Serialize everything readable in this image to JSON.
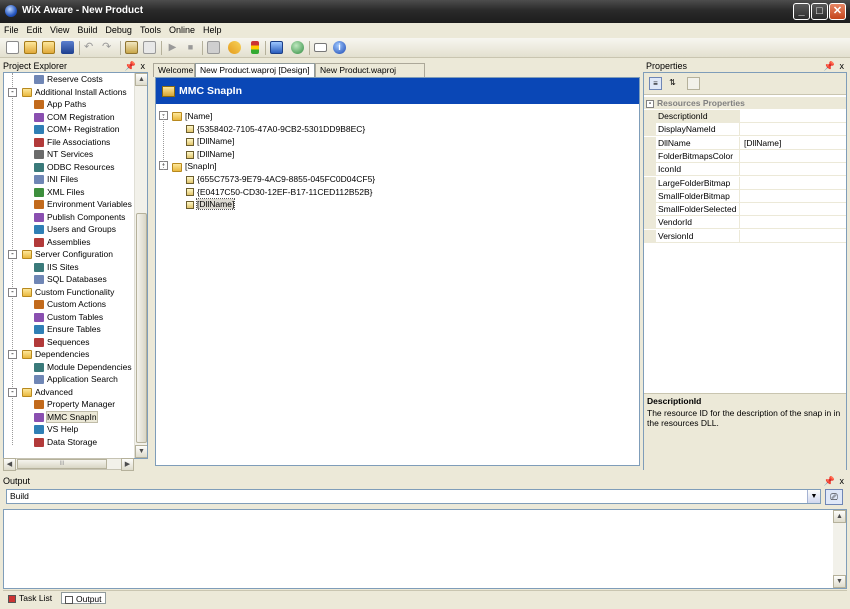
{
  "window": {
    "title": "WiX Aware - New Product"
  },
  "menu": [
    "File",
    "Edit",
    "View",
    "Build",
    "Debug",
    "Tools",
    "Online",
    "Help"
  ],
  "project_explorer": {
    "title": "Project Explorer",
    "items": [
      {
        "label": "Reserve Costs",
        "level": 2,
        "icon": "reserve-costs-icon"
      },
      {
        "label": "Additional Install Actions",
        "level": 1,
        "icon": "folder-icon",
        "expander": "-"
      },
      {
        "label": "App Paths",
        "level": 2,
        "icon": "app-paths-icon"
      },
      {
        "label": "COM Registration",
        "level": 2,
        "icon": "com-icon"
      },
      {
        "label": "COM+ Registration",
        "level": 2,
        "icon": "com-plus-icon"
      },
      {
        "label": "File Associations",
        "level": 2,
        "icon": "file-associations-icon"
      },
      {
        "label": "NT Services",
        "level": 2,
        "icon": "nt-services-icon"
      },
      {
        "label": "ODBC Resources",
        "level": 2,
        "icon": "odbc-icon"
      },
      {
        "label": "INI Files",
        "level": 2,
        "icon": "ini-icon"
      },
      {
        "label": "XML Files",
        "level": 2,
        "icon": "xml-icon"
      },
      {
        "label": "Environment Variables",
        "level": 2,
        "icon": "environment-icon"
      },
      {
        "label": "Publish Components",
        "level": 2,
        "icon": "publish-icon"
      },
      {
        "label": "Users and Groups",
        "level": 2,
        "icon": "users-icon"
      },
      {
        "label": "Assemblies",
        "level": 2,
        "icon": "assemblies-icon"
      },
      {
        "label": "Server Configuration",
        "level": 1,
        "icon": "folder-icon",
        "expander": "-"
      },
      {
        "label": "IIS Sites",
        "level": 2,
        "icon": "iis-icon"
      },
      {
        "label": "SQL Databases",
        "level": 2,
        "icon": "sql-icon"
      },
      {
        "label": "Custom Functionality",
        "level": 1,
        "icon": "folder-icon",
        "expander": "-"
      },
      {
        "label": "Custom Actions",
        "level": 2,
        "icon": "custom-actions-icon"
      },
      {
        "label": "Custom Tables",
        "level": 2,
        "icon": "custom-tables-icon"
      },
      {
        "label": "Ensure Tables",
        "level": 2,
        "icon": "ensure-tables-icon"
      },
      {
        "label": "Sequences",
        "level": 2,
        "icon": "sequences-icon"
      },
      {
        "label": "Dependencies",
        "level": 1,
        "icon": "folder-icon",
        "expander": "-"
      },
      {
        "label": "Module Dependencies",
        "level": 2,
        "icon": "module-dependencies-icon"
      },
      {
        "label": "Application Search",
        "level": 2,
        "icon": "search-icon"
      },
      {
        "label": "Advanced",
        "level": 1,
        "icon": "folder-icon",
        "expander": "-"
      },
      {
        "label": "Property Manager",
        "level": 2,
        "icon": "property-manager-icon"
      },
      {
        "label": "MMC SnapIn",
        "level": 2,
        "icon": "mmc-icon",
        "selected": true
      },
      {
        "label": "VS Help",
        "level": 2,
        "icon": "vs-help-icon"
      },
      {
        "label": "Data Storage",
        "level": 2,
        "icon": "data-storage-icon"
      }
    ],
    "hscroll_thumb": "III"
  },
  "tabs": [
    {
      "label": "Welcome"
    },
    {
      "label": "New Product.waproj [Design]",
      "active": true
    },
    {
      "label": "New Product.waproj [XML]"
    }
  ],
  "designer": {
    "header": "MMC SnapIn",
    "nodes": [
      {
        "label": "[Name]",
        "level": 0,
        "type": "folder",
        "expander": "-"
      },
      {
        "label": "{5358402-7105-47A0-9CB2-5301DD9B8EC}",
        "level": 1,
        "type": "key"
      },
      {
        "label": "[DllName]",
        "level": 1,
        "type": "key"
      },
      {
        "label": "[DllName]",
        "level": 1,
        "type": "key"
      },
      {
        "label": "[SnapIn]",
        "level": 0,
        "type": "folder",
        "expander": "-"
      },
      {
        "label": "{655C7573-9E79-4AC9-8855-045FC0D04CF5}",
        "level": 1,
        "type": "key"
      },
      {
        "label": "{E0417C50-CD30-12EF-B17-11CED112B52B}",
        "level": 1,
        "type": "key"
      },
      {
        "label": "[DllName]",
        "level": 1,
        "type": "key",
        "selected": true
      }
    ]
  },
  "properties": {
    "title": "Properties",
    "group": "Resources Properties",
    "rows": [
      {
        "name": "DescriptionId",
        "value": "",
        "selected": true
      },
      {
        "name": "DisplayNameId",
        "value": ""
      },
      {
        "name": "DllName",
        "value": "[DllName]"
      },
      {
        "name": "FolderBitmapsColor",
        "value": ""
      },
      {
        "name": "IconId",
        "value": ""
      },
      {
        "name": "LargeFolderBitmap",
        "value": ""
      },
      {
        "name": "SmallFolderBitmap",
        "value": ""
      },
      {
        "name": "SmallFolderSelected",
        "value": ""
      },
      {
        "name": "VendorId",
        "value": ""
      },
      {
        "name": "VersionId",
        "value": ""
      }
    ],
    "description_title": "DescriptionId",
    "description_text": "The resource ID for the description of the snap in in the resources DLL."
  },
  "output": {
    "title": "Output",
    "source": "Build"
  },
  "bottom_tabs": [
    {
      "label": "Task List"
    },
    {
      "label": "Output",
      "active": true
    }
  ],
  "colors": {
    "accent": "#0a47b6",
    "titlebar": "#2a2a2a"
  }
}
